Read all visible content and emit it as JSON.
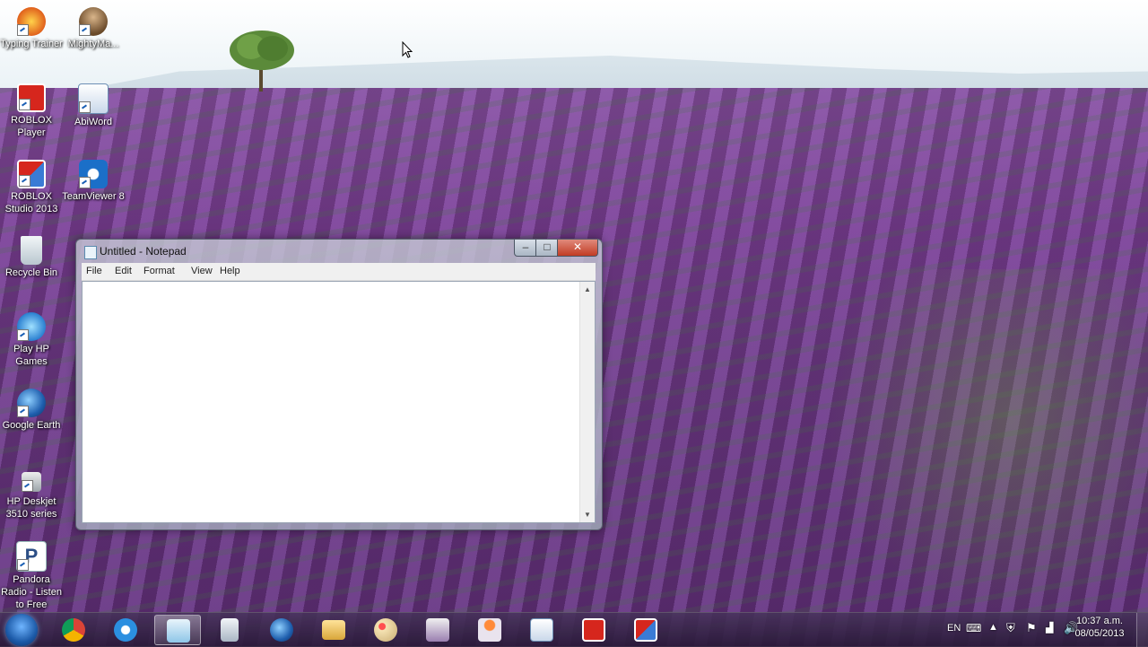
{
  "desktop": {
    "icons": [
      {
        "label": "Typing Trainer",
        "icon": "typing-trainer-icon"
      },
      {
        "label": "MightyMa...",
        "icon": "mightymacros-icon"
      },
      {
        "label": "ROBLOX Player",
        "icon": "roblox-player-icon"
      },
      {
        "label": "AbiWord",
        "icon": "abiword-icon"
      },
      {
        "label": "ROBLOX Studio 2013",
        "icon": "roblox-studio-icon"
      },
      {
        "label": "TeamViewer 8",
        "icon": "teamviewer-icon"
      },
      {
        "label": "Recycle Bin",
        "icon": "recycle-bin-icon"
      },
      {
        "label": "Play HP Games",
        "icon": "hp-games-icon"
      },
      {
        "label": "Google Earth",
        "icon": "google-earth-icon"
      },
      {
        "label": "HP Deskjet 3510 series",
        "icon": "printer-icon"
      },
      {
        "label": "Pandora Radio - Listen to Free",
        "icon": "pandora-icon"
      }
    ]
  },
  "notepad": {
    "title": "Untitled - Notepad",
    "controls": {
      "minimize": "–",
      "maximize": "□",
      "close": "✕"
    },
    "menu": [
      "File",
      "Edit",
      "Format",
      "View",
      "Help"
    ],
    "content": ""
  },
  "taskbar": {
    "apps": [
      {
        "name": "Google Chrome",
        "icon": "chrome-icon"
      },
      {
        "name": "Internet Explorer",
        "icon": "internet-explorer-icon"
      },
      {
        "name": "Notepad",
        "icon": "notepad-icon",
        "active": true
      },
      {
        "name": "Calculator",
        "icon": "calculator-icon"
      },
      {
        "name": "Google Earth",
        "icon": "google-earth-icon"
      },
      {
        "name": "Windows Explorer",
        "icon": "folder-icon"
      },
      {
        "name": "Paint",
        "icon": "paint-icon"
      },
      {
        "name": "App 4",
        "icon": "app4-icon"
      },
      {
        "name": "Award App",
        "icon": "award-icon"
      },
      {
        "name": "AbiWord",
        "icon": "abiword-icon"
      },
      {
        "name": "ROBLOX Player",
        "icon": "roblox-icon"
      },
      {
        "name": "ROBLOX Studio",
        "icon": "roblox-studio-icon"
      }
    ],
    "tray": {
      "language": "EN",
      "time": "10:37 a.m.",
      "date": "08/05/2013"
    }
  },
  "colors": {
    "roblox_red": "#d6261d",
    "teamviewer_blue": "#1b6fc8",
    "taskbar": "#3a2a4a",
    "close_red": "#c23c24"
  }
}
